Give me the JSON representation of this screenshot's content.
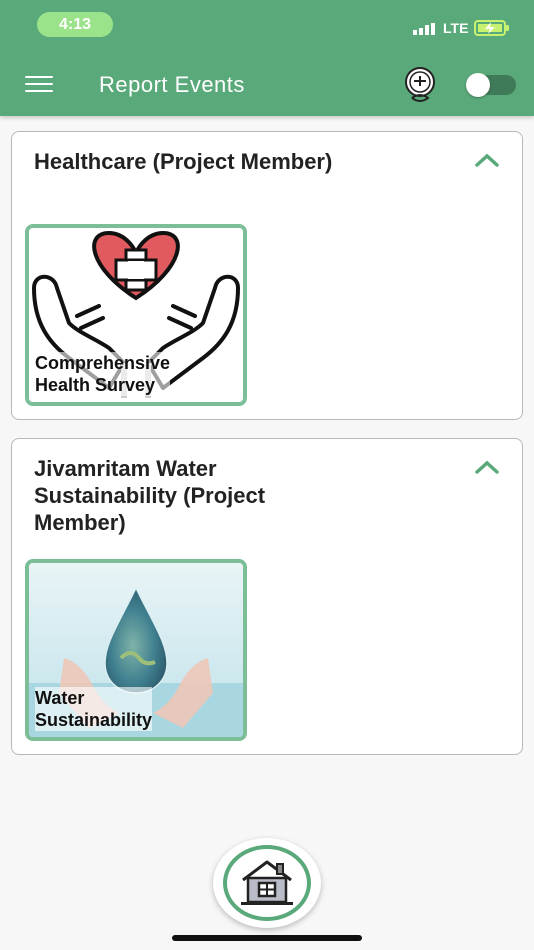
{
  "status_bar": {
    "time": "4:13",
    "network": "LTE"
  },
  "header": {
    "title": "Report Events"
  },
  "sections": [
    {
      "title": "Healthcare (Project Member)",
      "items": [
        {
          "label_line1": "Comprehensive",
          "label_line2": "Health Survey"
        }
      ]
    },
    {
      "title": "Jivamritam Water Sustainability (Project Member)",
      "items": [
        {
          "label_line1": "Water",
          "label_line2": "Sustainability"
        }
      ]
    }
  ],
  "colors": {
    "primary": "#5aa97a",
    "accent_border": "#7bbe98",
    "heart": "#e05a5f"
  },
  "icons": [
    "menu-icon",
    "logo-icon",
    "chevron-up-icon",
    "home-icon"
  ]
}
